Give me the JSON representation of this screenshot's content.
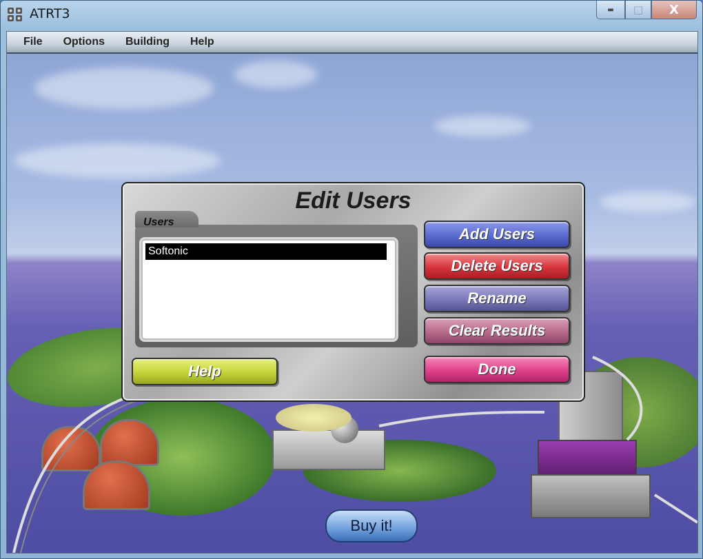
{
  "window": {
    "title": "ATRT3",
    "close_glyph": "X",
    "min_glyph": "▬",
    "max_glyph": "□"
  },
  "menu": [
    "File",
    "Options",
    "Building",
    "Help"
  ],
  "dialog": {
    "title": "Edit Users",
    "users_label": "Users",
    "users": [
      "Softonic"
    ],
    "buttons": {
      "add_users": "Add Users",
      "delete_users": "Delete Users",
      "rename": "Rename",
      "clear_results": "Clear Results",
      "done": "Done",
      "help": "Help"
    }
  },
  "buy_button": "Buy it!",
  "colors": {
    "add_users": "#5a6cd0",
    "delete_users": "#d8343c",
    "rename": "#7a78b8",
    "clear_results": "#b86a8a",
    "done": "#e0408a",
    "help": "#c4d43a"
  }
}
